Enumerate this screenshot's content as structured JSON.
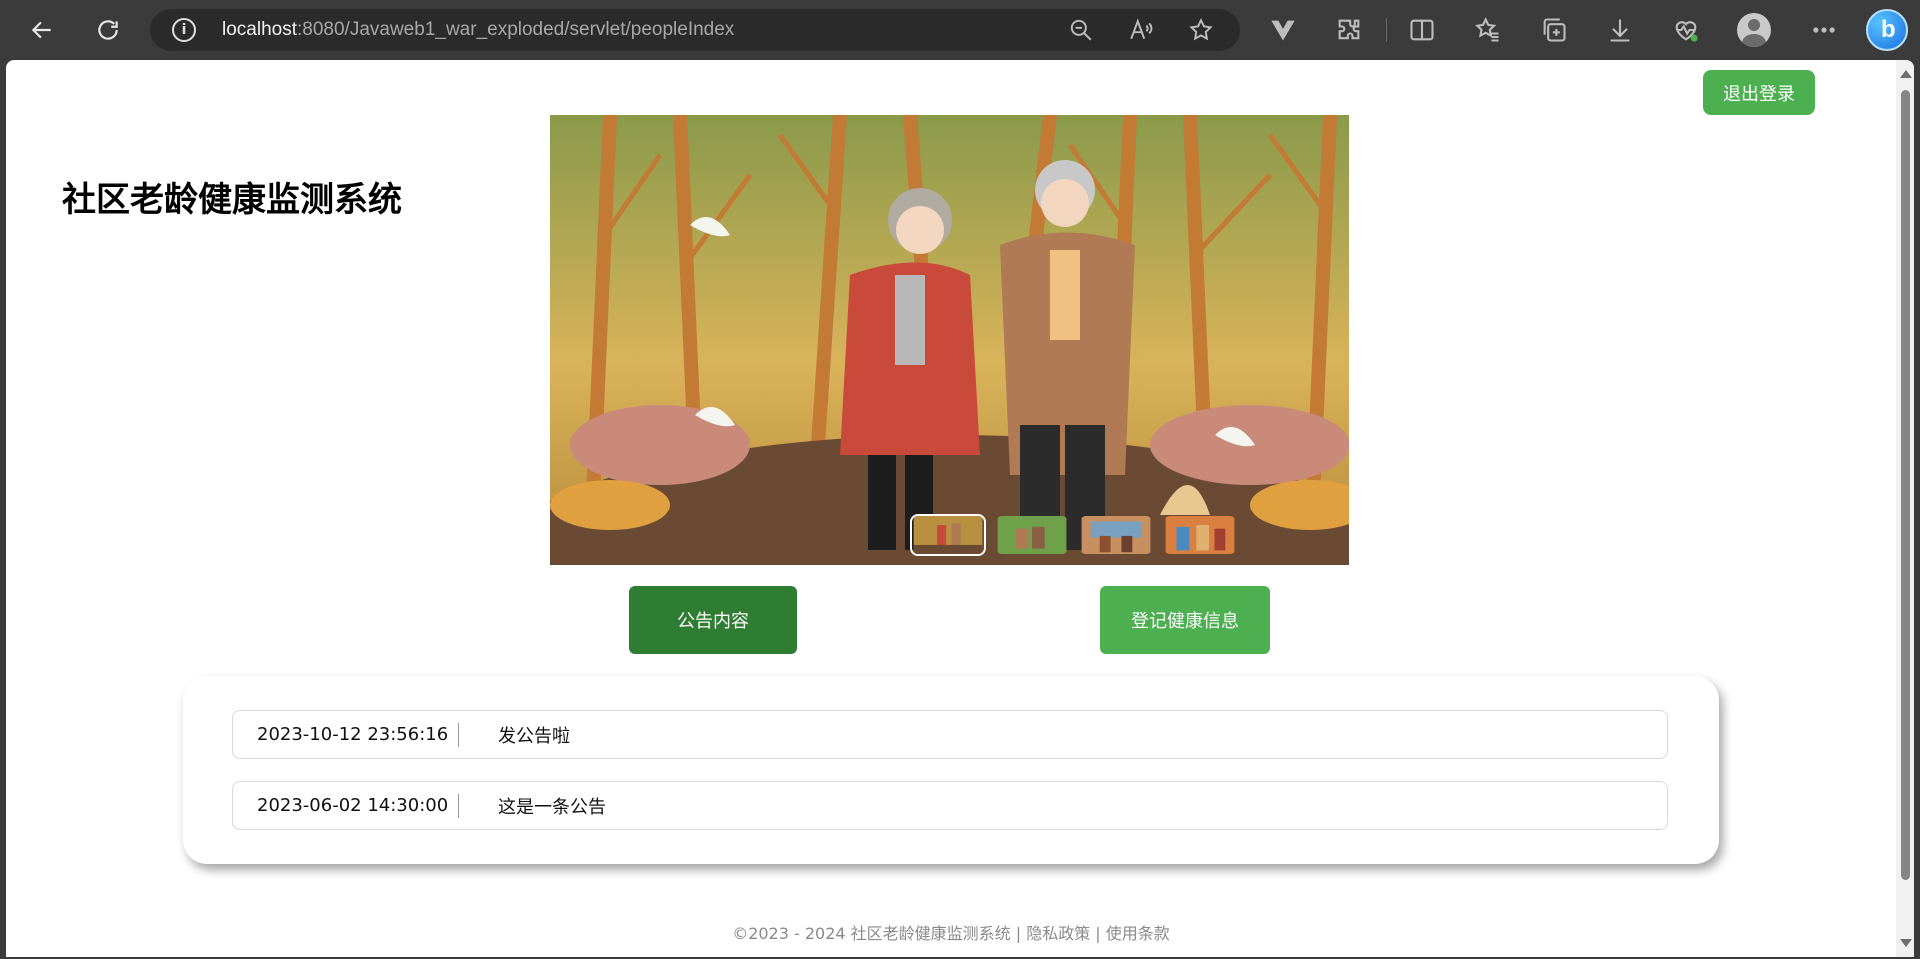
{
  "browser": {
    "url_host": "localhost",
    "url_path": ":8080/Javaweb1_war_exploded/servlet/peopleIndex",
    "icons": [
      "back-icon",
      "refresh-icon",
      "info-icon",
      "zoom-out-icon",
      "read-aloud-icon",
      "favorite-star-icon",
      "vue-devtools-icon",
      "extensions-icon",
      "split-screen-icon",
      "favorites-icon",
      "collections-icon",
      "downloads-icon",
      "browser-essentials-icon",
      "profile-icon",
      "more-icon",
      "bing-copilot-icon"
    ]
  },
  "header": {
    "logout_label": "退出登录",
    "site_title": "社区老龄健康监测系统"
  },
  "carousel": {
    "slide_count": 4,
    "active_index": 0
  },
  "tabs": {
    "notice_label": "公告内容",
    "health_label": "登记健康信息"
  },
  "notices": [
    {
      "date": "2023-10-12 23:56:16",
      "text": "发公告啦"
    },
    {
      "date": "2023-06-02 14:30:00",
      "text": "这是一条公告"
    }
  ],
  "footer": {
    "text": "©2023 - 2024 社区老龄健康监测系统 | 隐私政策 | 使用条款"
  },
  "colors": {
    "primary_green": "#4caf50",
    "dark_green": "#2e7d32",
    "browser_chrome": "#3b3b3b"
  }
}
